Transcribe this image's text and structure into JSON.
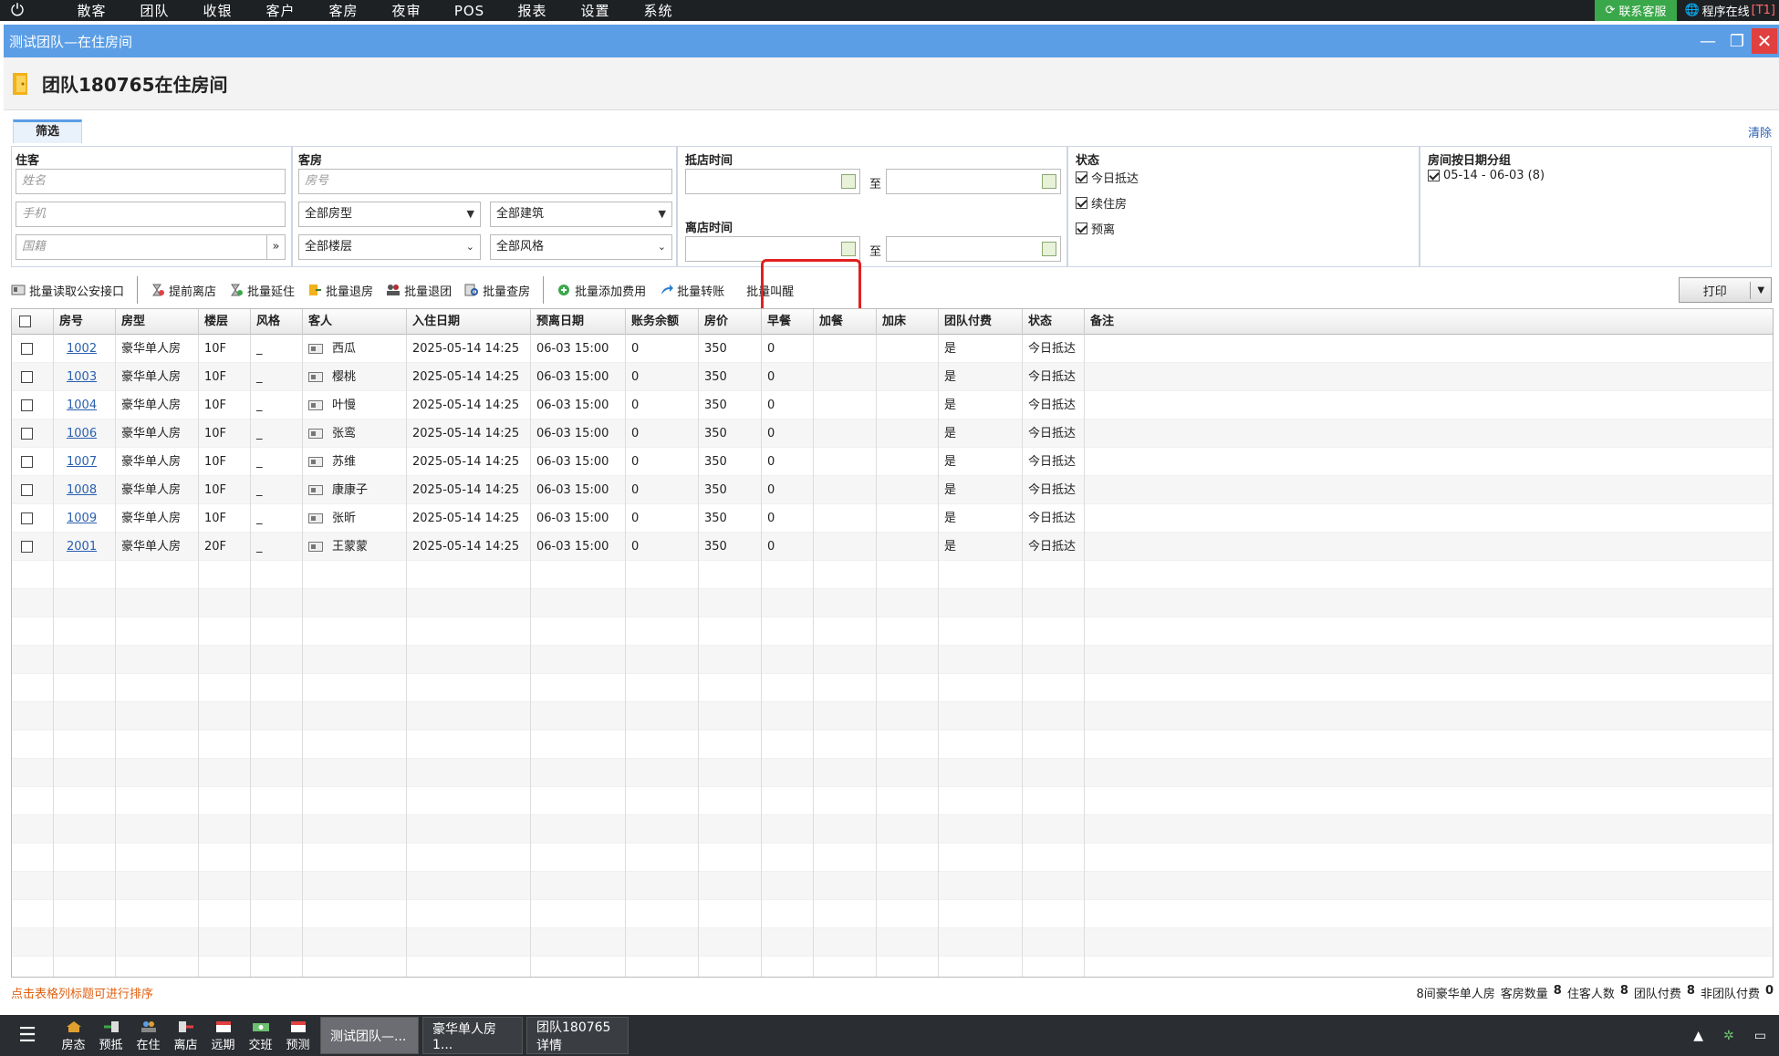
{
  "menubar": {
    "items": [
      "散客",
      "团队",
      "收银",
      "客户",
      "客房",
      "夜审",
      "POS",
      "报表",
      "设置",
      "系统"
    ],
    "service": "联系客服",
    "online": "程序在线",
    "online_tag": "[T1]"
  },
  "window": {
    "title": "测试团队—在住房间",
    "minimize": "—",
    "restore": "❐",
    "close": "✕"
  },
  "header": {
    "title": "团队180765在住房间"
  },
  "filter": {
    "tab": "筛选",
    "clear": "清除",
    "guest": {
      "label": "住客",
      "name_ph": "姓名",
      "phone_ph": "手机",
      "nation_ph": "国籍"
    },
    "room": {
      "label": "客房",
      "roomno_ph": "房号",
      "room_type": "全部房型",
      "building": "全部建筑",
      "floor": "全部楼层",
      "style": "全部风格"
    },
    "arrival": {
      "label": "抵店时间",
      "to": "至"
    },
    "departure": {
      "label": "离店时间",
      "to": "至"
    },
    "status": {
      "label": "状态",
      "options": [
        {
          "label": "今日抵达",
          "checked": true
        },
        {
          "label": "续住房",
          "checked": true
        },
        {
          "label": "预离",
          "checked": true
        }
      ]
    },
    "dategroup": {
      "label": "房间按日期分组",
      "options": [
        {
          "label": "05-14 - 06-03 (8)",
          "checked": true
        }
      ]
    }
  },
  "toolbar": {
    "read_police": "批量读取公安接口",
    "early_checkout": "提前离店",
    "extend": "批量延住",
    "checkout": "批量退房",
    "team_checkout": "批量退团",
    "check_room": "批量查房",
    "add_fee": "批量添加费用",
    "transfer": "批量转账",
    "wakeup": "批量叫醒",
    "print": "打印"
  },
  "table": {
    "columns": [
      "房号",
      "房型",
      "楼层",
      "风格",
      "客人",
      "入住日期",
      "预离日期",
      "账务余额",
      "房价",
      "早餐",
      "加餐",
      "加床",
      "团队付费",
      "状态",
      "备注"
    ],
    "rows": [
      {
        "room": "1002",
        "type": "豪华单人房",
        "floor": "10F",
        "style": "_",
        "guest": "西瓜",
        "checkin": "2025-05-14 14:25",
        "checkout": "06-03 15:00",
        "balance": "0",
        "price": "350",
        "breakfast": "0",
        "extra_meal": "",
        "extra_bed": "",
        "team_pay": "是",
        "status": "今日抵达",
        "note": ""
      },
      {
        "room": "1003",
        "type": "豪华单人房",
        "floor": "10F",
        "style": "_",
        "guest": "樱桃",
        "checkin": "2025-05-14 14:25",
        "checkout": "06-03 15:00",
        "balance": "0",
        "price": "350",
        "breakfast": "0",
        "extra_meal": "",
        "extra_bed": "",
        "team_pay": "是",
        "status": "今日抵达",
        "note": ""
      },
      {
        "room": "1004",
        "type": "豪华单人房",
        "floor": "10F",
        "style": "_",
        "guest": "叶慢",
        "checkin": "2025-05-14 14:25",
        "checkout": "06-03 15:00",
        "balance": "0",
        "price": "350",
        "breakfast": "0",
        "extra_meal": "",
        "extra_bed": "",
        "team_pay": "是",
        "status": "今日抵达",
        "note": ""
      },
      {
        "room": "1006",
        "type": "豪华单人房",
        "floor": "10F",
        "style": "_",
        "guest": "张鸾",
        "checkin": "2025-05-14 14:25",
        "checkout": "06-03 15:00",
        "balance": "0",
        "price": "350",
        "breakfast": "0",
        "extra_meal": "",
        "extra_bed": "",
        "team_pay": "是",
        "status": "今日抵达",
        "note": ""
      },
      {
        "room": "1007",
        "type": "豪华单人房",
        "floor": "10F",
        "style": "_",
        "guest": "苏维",
        "checkin": "2025-05-14 14:25",
        "checkout": "06-03 15:00",
        "balance": "0",
        "price": "350",
        "breakfast": "0",
        "extra_meal": "",
        "extra_bed": "",
        "team_pay": "是",
        "status": "今日抵达",
        "note": ""
      },
      {
        "room": "1008",
        "type": "豪华单人房",
        "floor": "10F",
        "style": "_",
        "guest": "康康子",
        "checkin": "2025-05-14 14:25",
        "checkout": "06-03 15:00",
        "balance": "0",
        "price": "350",
        "breakfast": "0",
        "extra_meal": "",
        "extra_bed": "",
        "team_pay": "是",
        "status": "今日抵达",
        "note": ""
      },
      {
        "room": "1009",
        "type": "豪华单人房",
        "floor": "10F",
        "style": "_",
        "guest": "张昕",
        "checkin": "2025-05-14 14:25",
        "checkout": "06-03 15:00",
        "balance": "0",
        "price": "350",
        "breakfast": "0",
        "extra_meal": "",
        "extra_bed": "",
        "team_pay": "是",
        "status": "今日抵达",
        "note": ""
      },
      {
        "room": "2001",
        "type": "豪华单人房",
        "floor": "20F",
        "style": "_",
        "guest": "王蒙蒙",
        "checkin": "2025-05-14 14:25",
        "checkout": "06-03 15:00",
        "balance": "0",
        "price": "350",
        "breakfast": "0",
        "extra_meal": "",
        "extra_bed": "",
        "team_pay": "是",
        "status": "今日抵达",
        "note": ""
      }
    ]
  },
  "status": {
    "hint": "点击表格列标题可进行排序",
    "summary": "8间豪华单人房",
    "rooms_label": "客房数量",
    "rooms": "8",
    "guests_label": "住客人数",
    "guests": "8",
    "team_pay_label": "团队付费",
    "team_pay": "8",
    "non_team_label": "非团队付费",
    "non_team": "0"
  },
  "taskbar": {
    "quick": [
      "房态",
      "预抵",
      "在住",
      "离店",
      "远期",
      "交班",
      "预测"
    ],
    "tasks": [
      "测试团队—...",
      "豪华单人房1...",
      "团队180765详情"
    ]
  }
}
